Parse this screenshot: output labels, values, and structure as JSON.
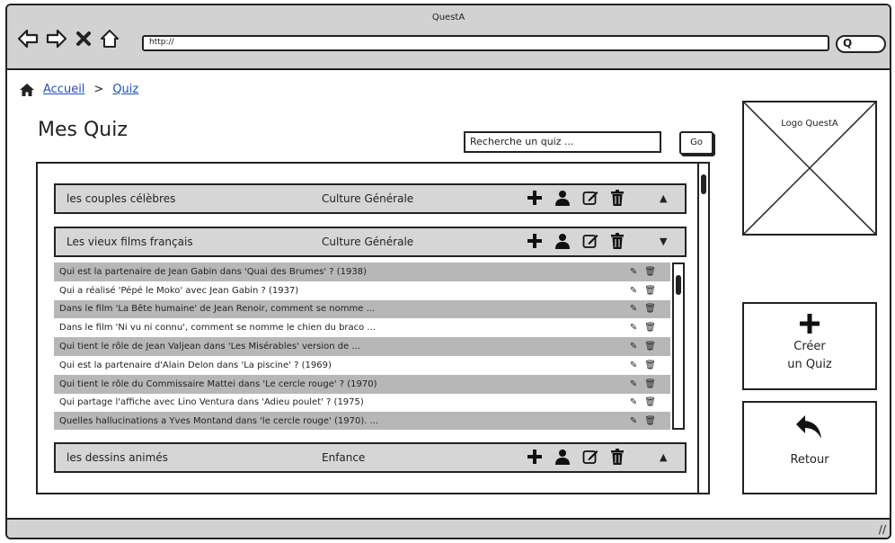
{
  "window": {
    "title": "QuestA",
    "url": "http://"
  },
  "breadcrumb": {
    "home": "Accueil",
    "separator": ">",
    "current": "Quiz"
  },
  "page": {
    "title": "Mes Quiz"
  },
  "search": {
    "placeholder": "Recherche un quiz ...",
    "go_label": "Go"
  },
  "quizzes": [
    {
      "name": "les couples célèbres",
      "category": "Culture Générale",
      "state": "collapsed"
    },
    {
      "name": "Les vieux films français",
      "category": "Culture Générale",
      "state": "expanded"
    },
    {
      "name": "les dessins animés",
      "category": "Enfance",
      "state": "collapsed"
    }
  ],
  "questions": [
    "Qui est la partenaire de Jean Gabin dans 'Quai des Brumes' ? (1938)",
    "Qui a réalisé 'Pépé le Moko' avec Jean Gabin ? (1937)",
    "Dans le film 'La Bête humaine' de Jean Renoir, comment se nomme ...",
    "Dans le film 'Ni vu ni connu', comment se nomme le chien du braco ...",
    "Qui tient le rôle de Jean Valjean dans 'Les Misérables' version de ...",
    "Qui est la partenaire d'Alain Delon dans 'La piscine' ? (1969)",
    "Qui tient le rôle du Commissaire Mattei dans 'Le cercle rouge' ? (1970)",
    "Qui partage l'affiche avec Lino Ventura dans 'Adieu poulet' ? (1975)",
    "Quelles hallucinations a Yves Montand dans 'le cercle rouge' (1970). ..."
  ],
  "sidebar": {
    "logo_label": "Logo QuestA",
    "create_line1": "Créer",
    "create_line2": "un Quiz",
    "back_label": "Retour"
  },
  "icons": {
    "add": "plus-icon",
    "user": "user-icon",
    "edit": "edit-icon",
    "delete": "trash-icon",
    "expand": "caret-icon",
    "home": "home-icon",
    "back": "reply-arrow-icon"
  }
}
